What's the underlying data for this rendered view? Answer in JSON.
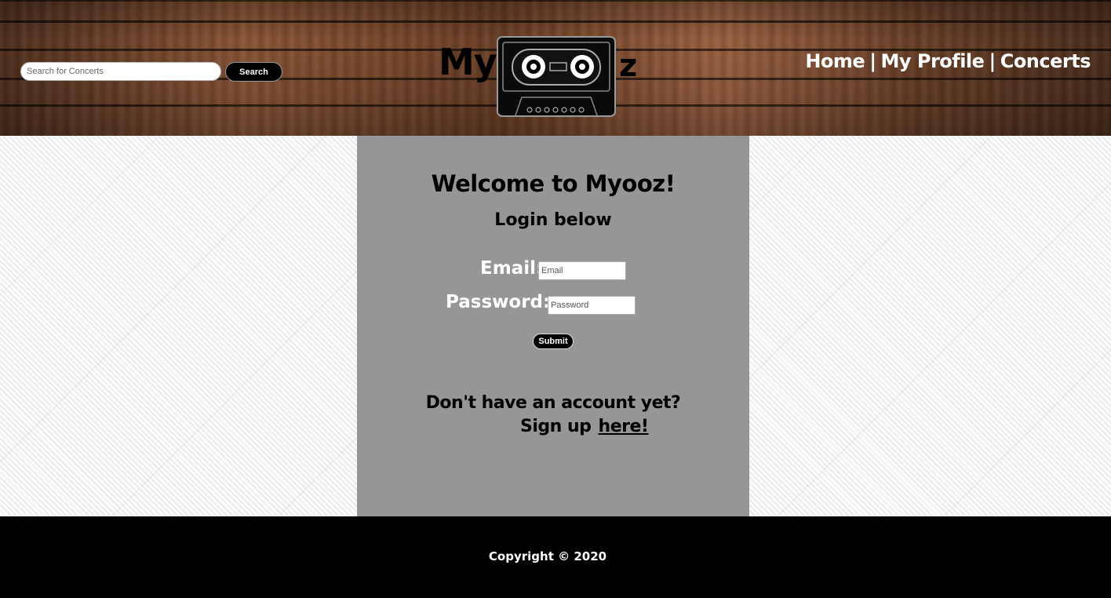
{
  "header": {
    "search": {
      "placeholder": "Search for Concerts",
      "value": "",
      "button_label": "Search"
    },
    "logo": {
      "text_left": "My",
      "text_right": "z",
      "icon": "cassette-icon"
    },
    "nav": {
      "items": [
        {
          "label": "Home"
        },
        {
          "label": "My Profile"
        },
        {
          "label": "Concerts"
        }
      ],
      "separator": "|"
    }
  },
  "main": {
    "title": "Welcome to Myooz!",
    "subtitle": "Login below",
    "form": {
      "email_label": "Email:",
      "email_placeholder": "Email",
      "password_label": "Password:",
      "password_placeholder": "Password",
      "submit_label": "Submit"
    },
    "signup": {
      "question": "Don't have an account yet?",
      "prompt": "Sign up",
      "link_text": "here!"
    }
  },
  "footer": {
    "copyright": "Copyright © 2020"
  },
  "colors": {
    "panel": "#969696",
    "footer": "#000000",
    "wood": "#7a4a2c",
    "button": "#000000"
  }
}
